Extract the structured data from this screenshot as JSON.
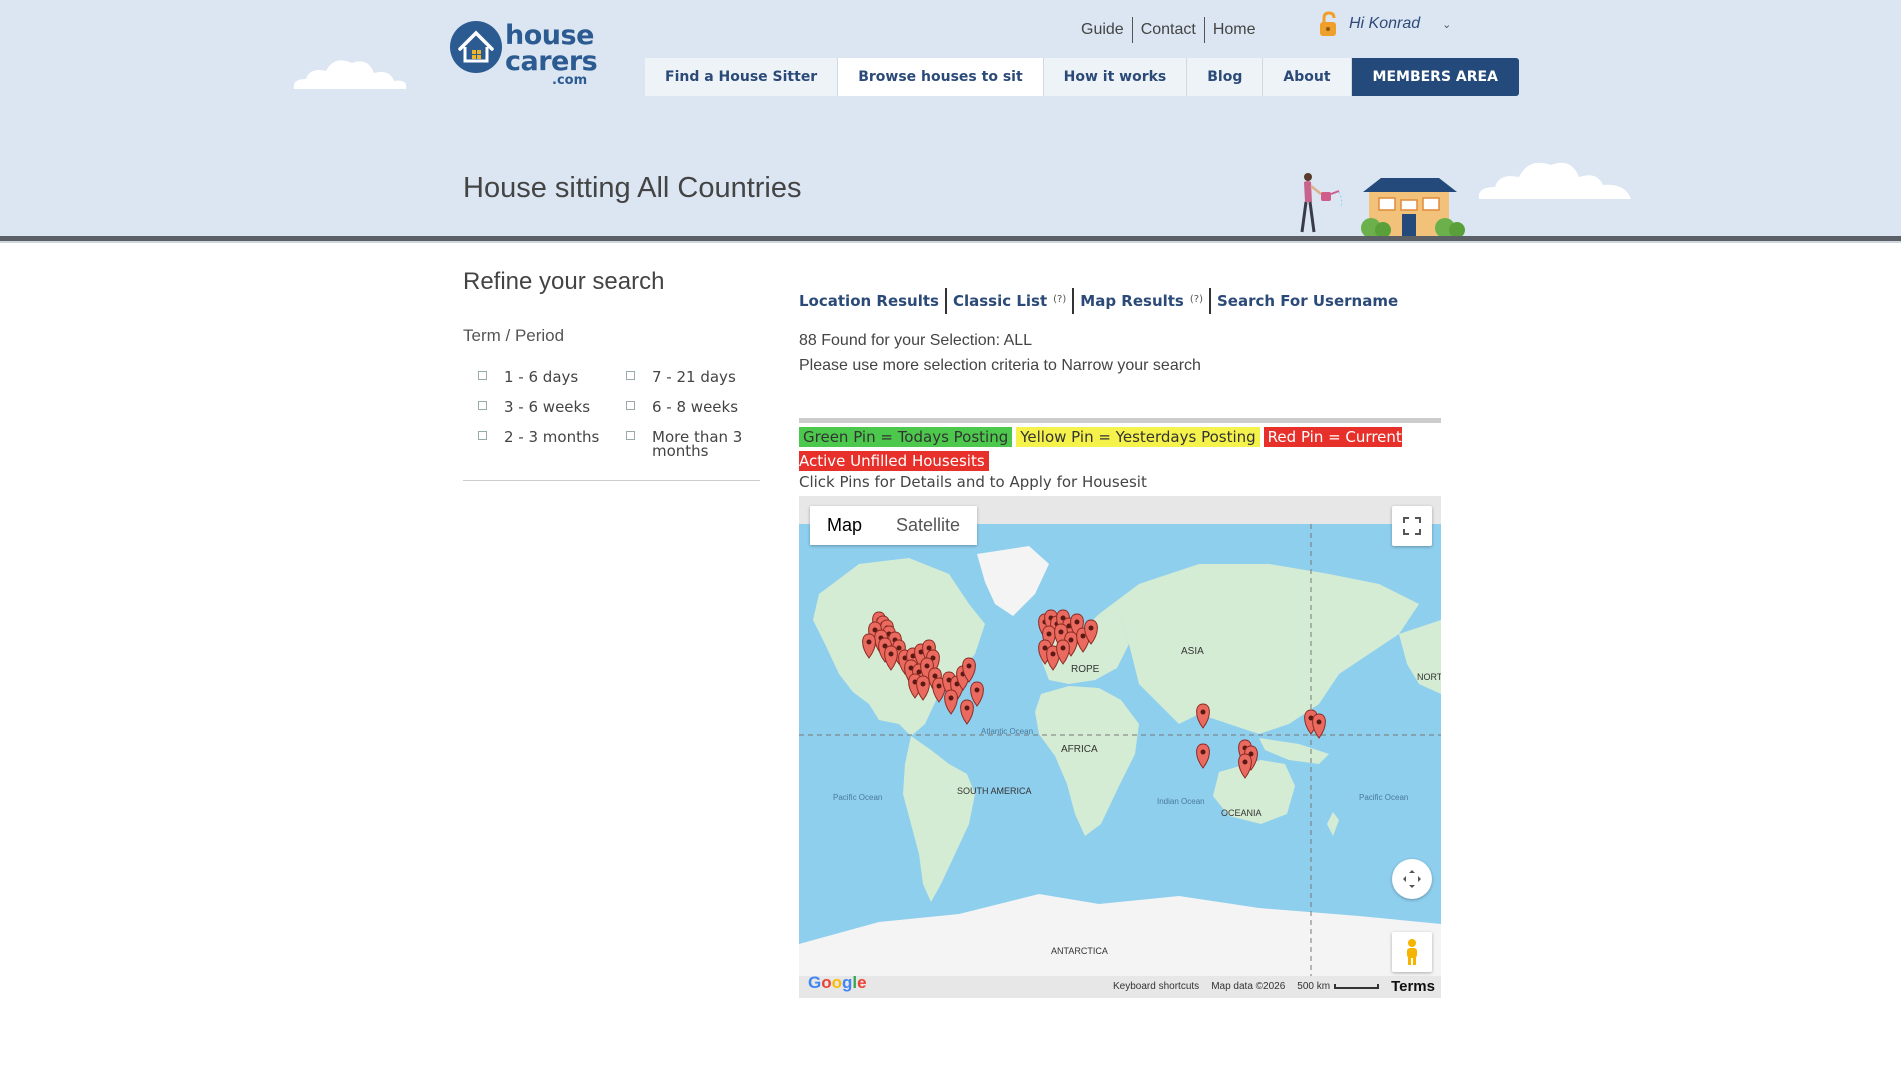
{
  "header": {
    "logo": {
      "line1": "house",
      "line2": "carers",
      "line3": ".com"
    },
    "toplinks": [
      "Guide",
      "Contact",
      "Home"
    ],
    "user_greeting": "Hi Konrad",
    "nav": [
      {
        "label": "Find a House Sitter"
      },
      {
        "label": "Browse houses to sit"
      },
      {
        "label": "How it works"
      },
      {
        "label": "Blog"
      },
      {
        "label": "About"
      },
      {
        "label": "MEMBERS AREA"
      }
    ],
    "page_title": "House sitting All Countries"
  },
  "sidebar": {
    "title": "Refine your search",
    "term_title": "Term / Period",
    "options": [
      "1 - 6 days",
      "7 - 21 days",
      "3 - 6 weeks",
      "6 - 8 weeks",
      "2 - 3 months",
      "More than 3 months"
    ]
  },
  "results": {
    "tabs": [
      {
        "label": "Location Results",
        "help": ""
      },
      {
        "label": "Classic List",
        "help": "(?)"
      },
      {
        "label": "Map Results",
        "help": "(?)"
      },
      {
        "label": "Search For Username",
        "help": ""
      }
    ],
    "found_text": "88 Found for your Selection: ALL",
    "narrow_text": "Please use more selection criteria to Narrow your search",
    "legend": {
      "green": "Green Pin = Todays Posting",
      "yellow": "Yellow Pin = Yesterdays Posting",
      "red": "Red Pin = Current Active Unfilled Housesits"
    },
    "click_note": "Click Pins for Details and to Apply for Housesit"
  },
  "map": {
    "map_button": "Map",
    "satellite_button": "Satellite",
    "google_logo": "Google",
    "keyboard_shortcuts": "Keyboard shortcuts",
    "map_data": "Map data ©2026",
    "scale": "500 km",
    "terms": "Terms",
    "labels": {
      "asia": "ASIA",
      "europe": "ROPE",
      "africa": "AFRICA",
      "north_america": "NORTH AMERICA",
      "south_america": "SOUTH AMERICA",
      "oceania": "OCEANIA",
      "antarctica": "ANTARCTICA",
      "atlantic": "Atlantic Ocean",
      "pacific": "Pacific Ocean",
      "indian": "Indian Ocean"
    },
    "colors": {
      "water": "#8fcfee",
      "land": "#d5ecd4",
      "ice": "#f4f4f4",
      "pin": "#ea6a60"
    }
  }
}
